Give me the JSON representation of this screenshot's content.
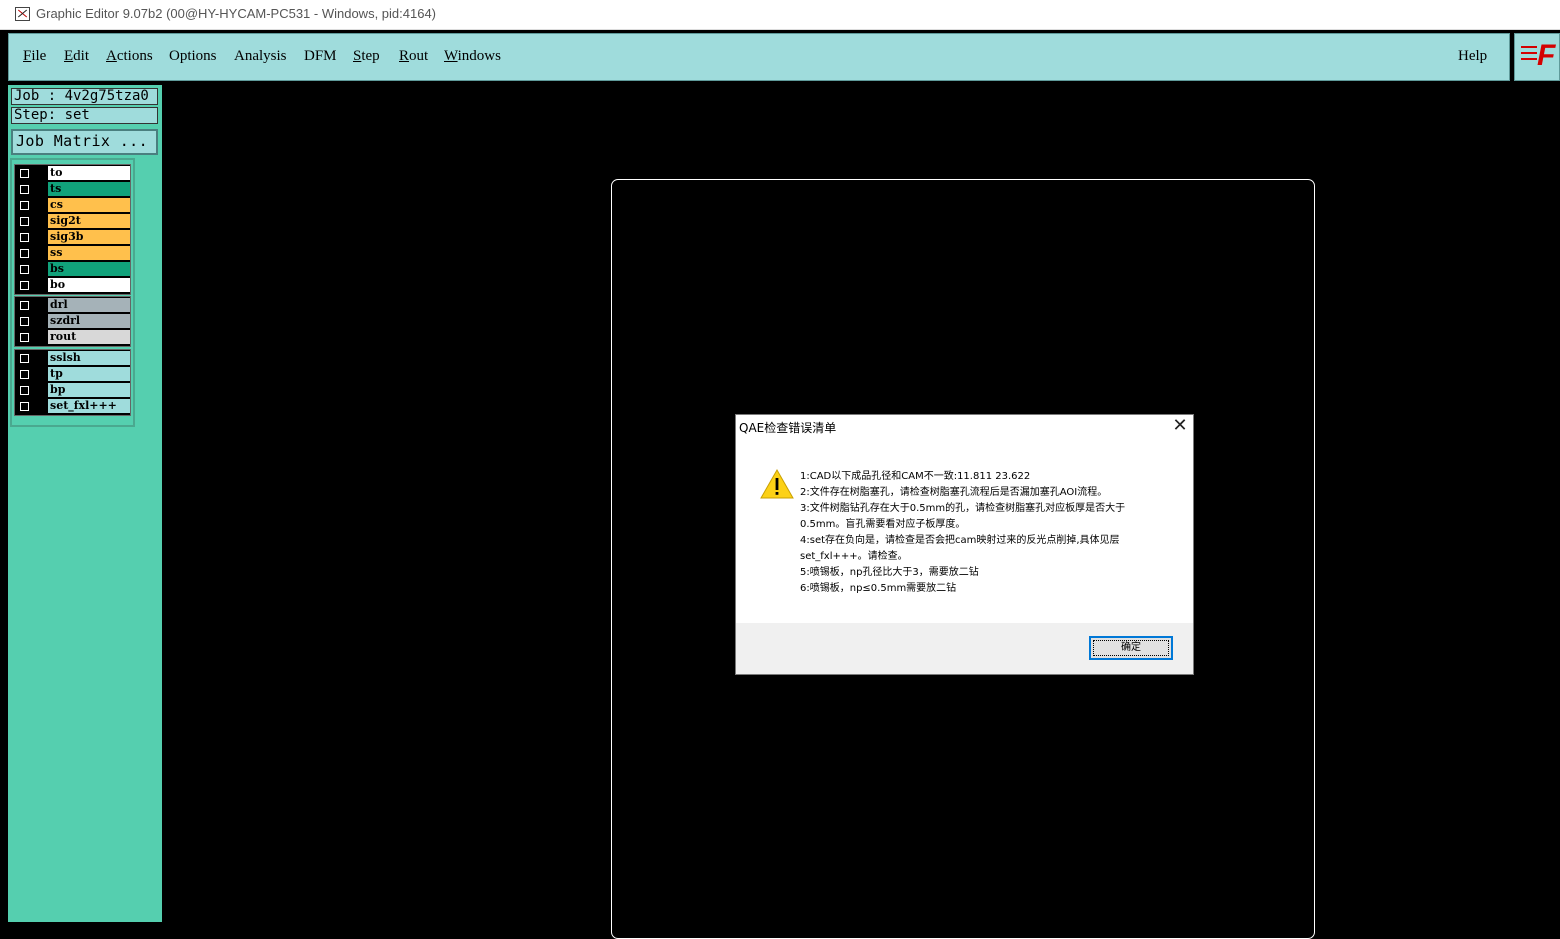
{
  "window": {
    "title": "Graphic Editor 9.07b2 (00@HY-HYCAM-PC531 - Windows, pid:4164)"
  },
  "menu": {
    "file": "File",
    "edit": "Edit",
    "actions": "Actions",
    "options": "Options",
    "analysis": "Analysis",
    "dfm": "DFM",
    "step": "Step",
    "rout": "Rout",
    "windows": "Windows",
    "help": "Help"
  },
  "logo": "F",
  "panel": {
    "job": "Job : 4v2g75tza0",
    "step": "Step: set",
    "job_matrix": "Job Matrix ..."
  },
  "layers": [
    {
      "name": "to",
      "color": "#ffffff"
    },
    {
      "name": "ts",
      "color": "#11a27b"
    },
    {
      "name": "cs",
      "color": "#ffc04c"
    },
    {
      "name": "sig2t",
      "color": "#ffc04c"
    },
    {
      "name": "sig3b",
      "color": "#ffc04c"
    },
    {
      "name": "ss",
      "color": "#ffc04c"
    },
    {
      "name": "bs",
      "color": "#11a27b"
    },
    {
      "name": "bo",
      "color": "#ffffff"
    },
    {
      "name": "drl",
      "color": "#a5b2b8"
    },
    {
      "name": "szdrl",
      "color": "#a5b2b8"
    },
    {
      "name": "rout",
      "color": "#d8d8d8"
    },
    {
      "name": "sslsh",
      "color": "#9fdcdc"
    },
    {
      "name": "tp",
      "color": "#9fdcdc"
    },
    {
      "name": "bp",
      "color": "#9fdcdc"
    },
    {
      "name": "set_fxl+++",
      "color": "#9fdcdc"
    }
  ],
  "dialog": {
    "title": "QAE检查错误清单",
    "close": "✕",
    "icon": "warning-icon",
    "lines": [
      " 1:CAD以下成品孔径和CAM不一致:11.811 23.622",
      " 2:文件存在树脂塞孔，请检查树脂塞孔流程后是否漏加塞孔AOI流程。",
      " 3:文件树脂钻孔存在大于0.5mm的孔，请检查树脂塞孔对应板厚是否大于",
      "0.5mm。盲孔需要看对应子板厚度。",
      " 4:set存在负向是，请检查是否会把cam映射过来的反光点削掉,具体见层",
      "set_fxl+++。请检查。",
      " 5:喷锡板，np孔径比大于3，需要放二钻",
      " 6:喷锡板，np≤0.5mm需要放二钻"
    ],
    "ok": "确定"
  }
}
